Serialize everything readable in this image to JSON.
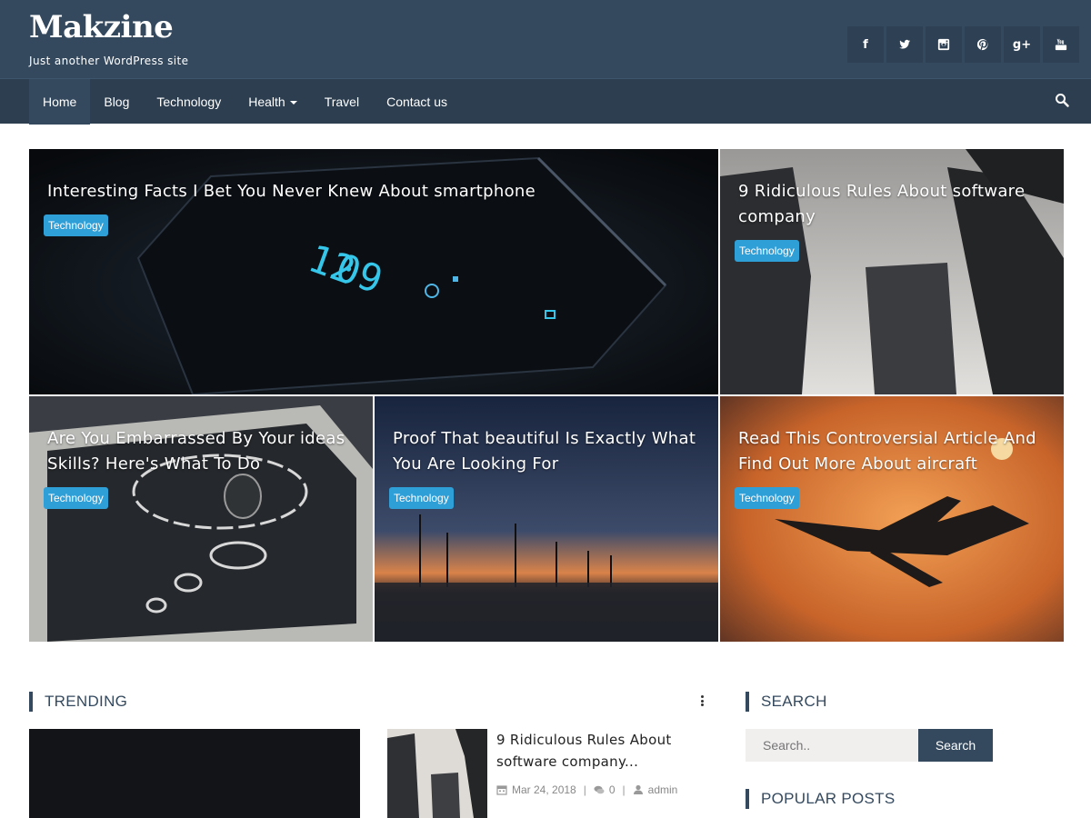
{
  "site": {
    "title": "Makzine",
    "tagline": "Just another WordPress site"
  },
  "social": [
    {
      "icon": "facebook-icon",
      "glyph": "f"
    },
    {
      "icon": "twitter-icon",
      "glyph": ""
    },
    {
      "icon": "instagram-icon",
      "glyph": ""
    },
    {
      "icon": "pinterest-icon",
      "glyph": ""
    },
    {
      "icon": "google-plus-icon",
      "glyph": "g+"
    },
    {
      "icon": "youtube-icon",
      "glyph": ""
    }
  ],
  "nav": {
    "items": [
      {
        "label": "Home",
        "active": true
      },
      {
        "label": "Blog"
      },
      {
        "label": "Technology"
      },
      {
        "label": "Health",
        "dropdown": true
      },
      {
        "label": "Travel"
      },
      {
        "label": "Contact us"
      }
    ]
  },
  "featured": [
    {
      "title": "Interesting Facts I Bet You Never Knew About smartphone",
      "category": "Technology"
    },
    {
      "title": "9 Ridiculous Rules About software company",
      "category": "Technology"
    },
    {
      "title": "Are You Embarrassed By Your ideas Skills? Here's What To Do",
      "category": "Technology"
    },
    {
      "title": "Proof That beautiful Is Exactly What You Are Looking For",
      "category": "Technology"
    },
    {
      "title": "Read This Controversial Article And Find Out More About aircraft",
      "category": "Technology"
    }
  ],
  "trending": {
    "heading": "TRENDING",
    "post": {
      "title": "9 Ridiculous Rules About software company...",
      "date": "Mar 24, 2018",
      "comments": "0",
      "author": "admin"
    }
  },
  "sidebar": {
    "search_heading": "SEARCH",
    "search_placeholder": "Search..",
    "search_button": "Search",
    "popular_heading": "POPULAR POSTS"
  },
  "colors": {
    "header": "#34495e",
    "nav": "#2c3e50",
    "badge": "#2f9fd8"
  }
}
